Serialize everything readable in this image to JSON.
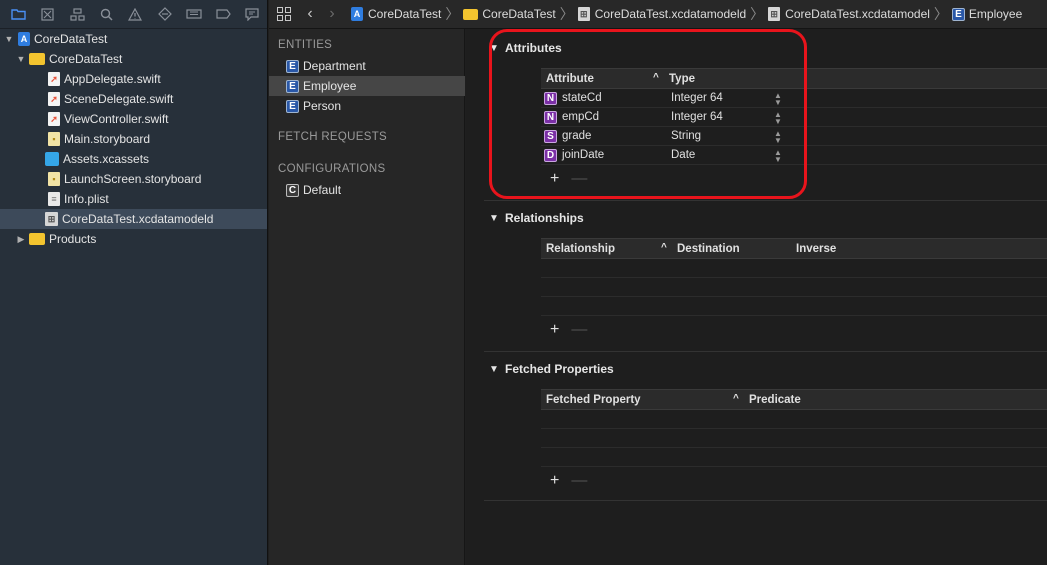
{
  "navigator": {
    "toolbar_icons": [
      "folder-icon",
      "source-control-icon",
      "hierarchy-icon",
      "search-icon",
      "warning-icon",
      "test-icon",
      "debug-icon",
      "breakpoint-icon",
      "report-icon"
    ],
    "tree": [
      {
        "label": "CoreDataTest",
        "icon": "project-icon",
        "level": 0,
        "expanded": true
      },
      {
        "label": "CoreDataTest",
        "icon": "folder-icon",
        "level": 1,
        "expanded": true
      },
      {
        "label": "AppDelegate.swift",
        "icon": "swift-file-icon",
        "level": 2
      },
      {
        "label": "SceneDelegate.swift",
        "icon": "swift-file-icon",
        "level": 2
      },
      {
        "label": "ViewController.swift",
        "icon": "swift-file-icon",
        "level": 2
      },
      {
        "label": "Main.storyboard",
        "icon": "storyboard-icon",
        "level": 2
      },
      {
        "label": "Assets.xcassets",
        "icon": "assets-icon",
        "level": 2
      },
      {
        "label": "LaunchScreen.storyboard",
        "icon": "storyboard-icon",
        "level": 2
      },
      {
        "label": "Info.plist",
        "icon": "plist-icon",
        "level": 2
      },
      {
        "label": "CoreDataTest.xcdatamodeld",
        "icon": "datamodel-icon",
        "level": 2,
        "selected": true
      },
      {
        "label": "Products",
        "icon": "folder-icon",
        "level": 1,
        "expanded": false
      }
    ]
  },
  "jumpbar": {
    "crumbs": [
      "CoreDataTest",
      "CoreDataTest",
      "CoreDataTest.xcdatamodeld",
      "CoreDataTest.xcdatamodel",
      "Employee"
    ]
  },
  "outline": {
    "entities_header": "ENTITIES",
    "entities": [
      {
        "badge": "E",
        "label": "Department"
      },
      {
        "badge": "E",
        "label": "Employee",
        "selected": true
      },
      {
        "badge": "E",
        "label": "Person"
      }
    ],
    "fetch_requests_header": "FETCH REQUESTS",
    "configurations_header": "CONFIGURATIONS",
    "configurations": [
      {
        "badge": "C",
        "label": "Default"
      }
    ]
  },
  "editor": {
    "attributes": {
      "title": "Attributes",
      "col_attribute": "Attribute",
      "col_type": "Type",
      "sort_indicator": "^",
      "rows": [
        {
          "badge": "N",
          "name": "stateCd",
          "type": "Integer 64"
        },
        {
          "badge": "N",
          "name": "empCd",
          "type": "Integer 64"
        },
        {
          "badge": "S",
          "name": "grade",
          "type": "String"
        },
        {
          "badge": "D",
          "name": "joinDate",
          "type": "Date"
        }
      ]
    },
    "relationships": {
      "title": "Relationships",
      "col_relationship": "Relationship",
      "col_destination": "Destination",
      "col_inverse": "Inverse"
    },
    "fetched_properties": {
      "title": "Fetched Properties",
      "col_property": "Fetched Property",
      "col_predicate": "Predicate"
    },
    "add_symbol": "+",
    "remove_symbol": "—",
    "highlight_color": "#e8141c"
  }
}
